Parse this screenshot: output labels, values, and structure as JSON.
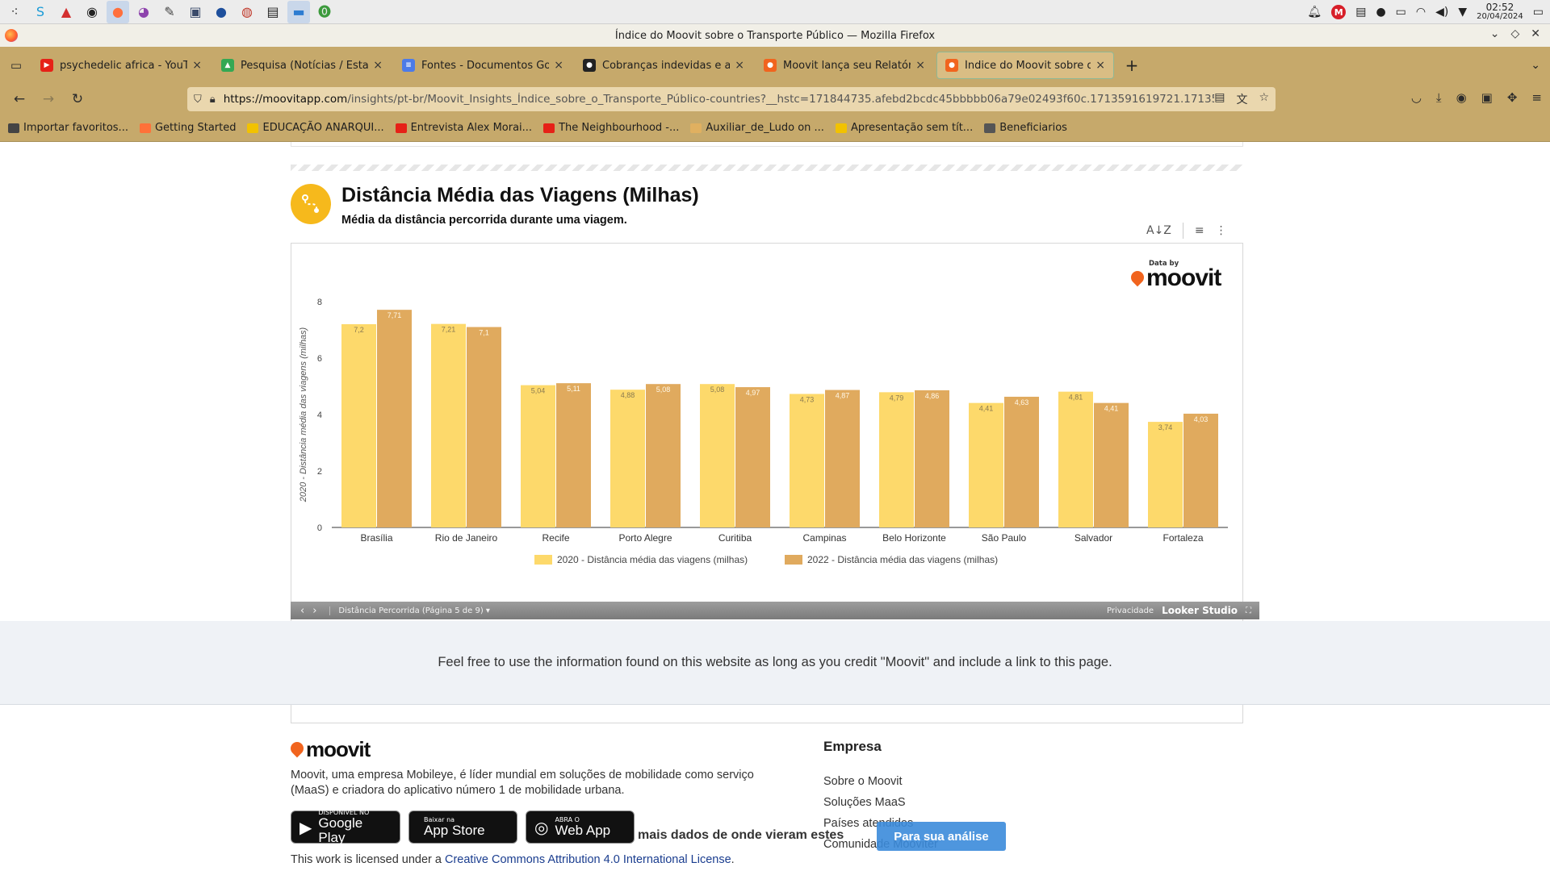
{
  "taskbar": {
    "apps": [
      {
        "name": "app-launcher-icon",
        "glyph": "⁖",
        "color": "#333"
      },
      {
        "name": "s-app-icon",
        "glyph": "S",
        "color": "#1a9bd7"
      },
      {
        "name": "red-triangle-app-icon",
        "glyph": "▲",
        "color": "#d32f2f"
      },
      {
        "name": "obs-icon",
        "glyph": "◉",
        "color": "#222"
      },
      {
        "name": "firefox-icon",
        "glyph": "●",
        "color": "#ff6f3c",
        "active": true
      },
      {
        "name": "color-app-icon",
        "glyph": "◕",
        "color": "#8e44ad"
      },
      {
        "name": "inkscape-icon",
        "glyph": "✎",
        "color": "#444"
      },
      {
        "name": "terminal-app-icon",
        "glyph": "▣",
        "color": "#3a4a6a"
      },
      {
        "name": "blue-circle-app-icon",
        "glyph": "●",
        "color": "#1e4f9c"
      },
      {
        "name": "chrome-icon",
        "glyph": "◍",
        "color": "#c0392b"
      },
      {
        "name": "screenshot-app-icon",
        "glyph": "▤",
        "color": "#222"
      },
      {
        "name": "file-manager-icon",
        "glyph": "▬",
        "color": "#2e7dd1",
        "active": true
      },
      {
        "name": "green-app-icon",
        "glyph": "⓿",
        "color": "#3c9a3c"
      }
    ],
    "clock_time": "02:52",
    "clock_date": "20/04/2024"
  },
  "window": {
    "title": "Índice do Moovit sobre o Transporte Público — Mozilla Firefox"
  },
  "tabs": [
    {
      "label": "psychedelic africa - YouTube",
      "fav_color": "#e62117",
      "fav_glyph": "▶"
    },
    {
      "label": "Pesquisa (Notícias / Estatísticas)",
      "fav_color": "#34a853",
      "fav_glyph": "▲"
    },
    {
      "label": "Fontes - Documentos Google",
      "fav_color": "#4c7be8",
      "fav_glyph": "≡"
    },
    {
      "label": "Cobranças indevidas e atrasos",
      "fav_color": "#222",
      "fav_glyph": "●"
    },
    {
      "label": "Moovit lança seu Relatório",
      "fav_color": "#f1641e",
      "fav_glyph": "●"
    },
    {
      "label": "Índice do Moovit sobre o Transporte",
      "fav_color": "#f1641e",
      "fav_glyph": "●",
      "active": true
    }
  ],
  "url": {
    "host": "https://moovitapp.com",
    "path": "/insights/pt-br/Moovit_Insights_Índice_sobre_o_Transporte_Público-countries?__hstc=171844735.afebd2bcdc45bbbbb06a79e02493f60c.1713591619721.171359"
  },
  "bookmarks": [
    {
      "label": "Importar favoritos...",
      "color": "#444"
    },
    {
      "label": "Getting Started",
      "color": "#ff7139"
    },
    {
      "label": "EDUCAÇÃO ANARQUI...",
      "color": "#f2c200"
    },
    {
      "label": "Entrevista Alex Morai...",
      "color": "#e62117"
    },
    {
      "label": "The Neighbourhood -...",
      "color": "#e62117"
    },
    {
      "label": "Auxiliar_de_Ludo on ...",
      "color": "#e0b060"
    },
    {
      "label": "Apresentação sem tít...",
      "color": "#f2c200"
    },
    {
      "label": "Beneficiarios",
      "color": "#555"
    }
  ],
  "report": {
    "title": "Distância Média das Viagens (Milhas)",
    "subtitle": "Média da distância percorrida durante uma viagem."
  },
  "chart_logo": {
    "by": "Data by",
    "word": "moovit"
  },
  "chart_data": {
    "type": "bar",
    "ylabel": "2020 - Distância média das viagens (milhas)",
    "ylim": [
      0,
      8
    ],
    "yticks": [
      0,
      2,
      4,
      6,
      8
    ],
    "categories": [
      "Brasília",
      "Rio de Janeiro",
      "Recife",
      "Porto Alegre",
      "Curitiba",
      "Campinas",
      "Belo Horizonte",
      "São Paulo",
      "Salvador",
      "Fortaleza"
    ],
    "series": [
      {
        "name": "2020 - Distância média das viagens (milhas)",
        "color": "#fdd96b",
        "values": [
          7.2,
          7.21,
          5.04,
          4.88,
          5.08,
          4.73,
          4.79,
          4.41,
          4.81,
          3.74
        ],
        "labels": [
          "7,2",
          "7,21",
          "5,04",
          "4,88",
          "5,08",
          "4,73",
          "4,79",
          "4,41",
          "4,81",
          "3,74"
        ]
      },
      {
        "name": "2022 - Distância média das viagens (milhas)",
        "color": "#e0aa5e",
        "values": [
          7.71,
          7.1,
          5.11,
          5.08,
          4.97,
          4.87,
          4.86,
          4.63,
          4.41,
          4.03
        ],
        "labels": [
          "7,71",
          "7,1",
          "5,11",
          "5,08",
          "4,97",
          "4,87",
          "4,86",
          "4,63",
          "4,41",
          "4,03"
        ]
      }
    ],
    "legend_position": "bottom-center",
    "grid": false
  },
  "looker": {
    "page": "Distância Percorrida (Página 5 de 9)",
    "privacy": "Privacidade",
    "brand": "Looker Studio"
  },
  "credit": "Feel free to use the information found on this website as long as you credit \"Moovit\" and include a link to this page.",
  "footer": {
    "logo": "moovit",
    "description": "Moovit, uma empresa Mobileye, é líder mundial em soluções de mobilidade como serviço (MaaS) e criadora do aplicativo número 1 de mobilidade urbana.",
    "company_title": "Empresa",
    "company_links": [
      "Sobre o Moovit",
      "Soluções MaaS",
      "Países atendidos",
      "Comunidade Mooviter"
    ],
    "stores": [
      {
        "small": "DISPONÍVEL NO",
        "big": "Google Play",
        "glyph": "▶"
      },
      {
        "small": "Baixar na",
        "big": "App Store",
        "glyph": ""
      },
      {
        "small": "ABRA O",
        "big": "Web App",
        "glyph": "◎"
      }
    ],
    "banner_text": "mais dados de onde vieram estes",
    "analysis_button": "Para sua análise",
    "license_prefix": "This work is licensed under a ",
    "license_link": "Creative Commons Attribution 4.0 International License",
    "license_suffix": "."
  }
}
